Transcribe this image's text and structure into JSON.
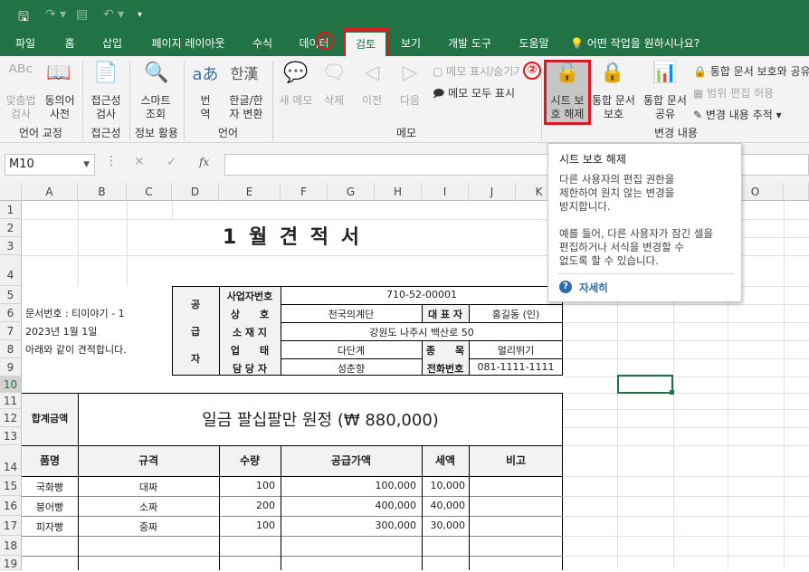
{
  "ribbon_tabs": [
    "파일",
    "홈",
    "삽입",
    "페이지 레이아웃",
    "수식",
    "데이터",
    "검토",
    "보기",
    "개발 도구",
    "도움말"
  ],
  "tellme": "어떤 작업을 원하시나요?",
  "annotations": {
    "step1": "①",
    "step2": "②"
  },
  "ribbon": {
    "spell": [
      "맞춤법",
      "검사"
    ],
    "thesaurus": [
      "동의어",
      "사전"
    ],
    "accessibility": [
      "접근성",
      "검사"
    ],
    "smart": [
      "스마트",
      "조회"
    ],
    "translate": [
      "번",
      "역"
    ],
    "hanhan": [
      "한글/한",
      "자 변환"
    ],
    "newmemo": "새 메모",
    "delete": "삭제",
    "prev": "이전",
    "next": "다음",
    "memo_show": "메모 표시/숨기기",
    "memo_all": "메모 모두 표시",
    "unprotect": [
      "시트 보",
      "호 해제"
    ],
    "protect_wb": [
      "통합 문서",
      "보호"
    ],
    "share_wb": [
      "통합 문서",
      "공유"
    ],
    "protect_share": "통합 문서 보호와 공유",
    "allow_edit": "범위 편집 허용",
    "track": "변경 내용 추적",
    "groups": {
      "proof": "언어 교정",
      "access": "접근성",
      "insights": "정보 활용",
      "language": "언어",
      "memo": "메모",
      "changes": "변경 내용"
    }
  },
  "namebox": "M10",
  "fx": "fx",
  "columns": [
    "A",
    "B",
    "C",
    "D",
    "E",
    "F",
    "G",
    "H",
    "I",
    "J",
    "K",
    "O"
  ],
  "rows": [
    "1",
    "2",
    "3",
    "4",
    "5",
    "6",
    "7",
    "8",
    "9",
    "10",
    "11",
    "12",
    "13",
    "14",
    "15",
    "16",
    "17",
    "18",
    "19"
  ],
  "tooltip": {
    "title": "시트 보호 해제",
    "p1": [
      "다른 사용자의 편집 권한을",
      "제한하여 원치 않는 변경을",
      "방지합니다."
    ],
    "p2": [
      "예를 들어, 다른 사용자가 잠긴 셀을",
      "편집하거나 서식을 변경할 수",
      "없도록 할 수 있습니다."
    ],
    "more": "자세히"
  },
  "sheet": {
    "title": "1 월 견 적 서",
    "docno": "문서번호 : 티이야기 - 1",
    "date": "2023년 1월 1일",
    "note": "아래와 같이 견적합니다.",
    "supplier_v": [
      "공",
      "급",
      "자"
    ],
    "bizno_label": "사업자번호",
    "bizno": "710-52-00001",
    "name_label": "상　　호",
    "name": "천국의계단",
    "ceo_label": "대 표 자",
    "ceo": "홍길동 (인)",
    "addr_label": "소 재 지",
    "addr": "강원도 나주시 백산로 50",
    "type_label": "업　　태",
    "type": "다단계",
    "item_label": "종　　목",
    "item": "멀리뛰기",
    "mgr_label": "담 당 자",
    "mgr": "성춘향",
    "tel_label": "전화번호",
    "tel": "081-1111-1111",
    "total_label": "합계금액",
    "total": "일금 팔십팔만 원정 (₩ 880,000)",
    "headers": [
      "품명",
      "규격",
      "수량",
      "공급가액",
      "세액",
      "비고"
    ],
    "items": [
      [
        "국화빵",
        "대짜",
        "100",
        "100,000",
        "10,000",
        ""
      ],
      [
        "붕어빵",
        "소짜",
        "200",
        "400,000",
        "40,000",
        ""
      ],
      [
        "피자빵",
        "중짜",
        "100",
        "300,000",
        "30,000",
        ""
      ]
    ]
  }
}
